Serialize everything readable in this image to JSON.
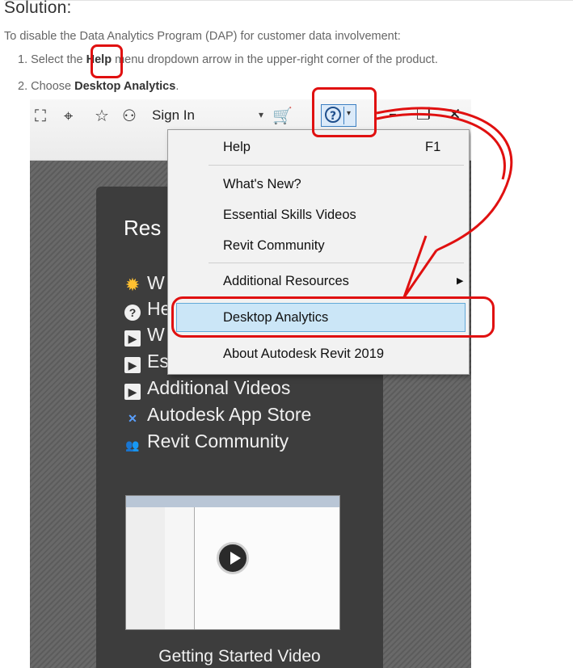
{
  "heading": "Solution:",
  "intro": "To disable the Data Analytics Program (DAP) for customer data involvement:",
  "steps": [
    {
      "num": "1.",
      "before": "Select the ",
      "bold": "Help",
      "after": " menu dropdown arrow in the upper-right corner of the product."
    },
    {
      "num": "2.",
      "before": "Choose ",
      "bold": "Desktop Analytics",
      "after": "."
    }
  ],
  "ribbon": {
    "icons": [
      "binoculars-icon",
      "satellite-icon",
      "star-icon",
      "user-icon"
    ],
    "sign_in": "Sign In",
    "dropdown_arrow": "▾",
    "cart_icon": "🛒",
    "help_glyph": "?",
    "help_dropdown": "▾",
    "minimize": "–",
    "restore": "❐",
    "close": "✕"
  },
  "menu": {
    "items": [
      {
        "label": "Help",
        "shortcut": "F1"
      },
      {
        "label": "What's New?"
      },
      {
        "label": "Essential Skills Videos"
      },
      {
        "label": "Revit Community"
      },
      {
        "label": "Additional Resources",
        "submenu": "▶"
      },
      {
        "label": "Desktop Analytics",
        "highlighted": true
      },
      {
        "label": "About Autodesk Revit 2019"
      }
    ]
  },
  "resources": {
    "title": "Res",
    "items": [
      {
        "label": "W",
        "icon": "sun-icon"
      },
      {
        "label": "He",
        "icon": "help-circle-icon"
      },
      {
        "label": "W",
        "icon": "play-icon"
      },
      {
        "label": "Es",
        "icon": "play-icon"
      },
      {
        "label": "Additional Videos",
        "icon": "play-icon"
      },
      {
        "label": "Autodesk App Store",
        "icon": "autodesk-x-icon"
      },
      {
        "label": "Revit Community",
        "icon": "people-icon"
      }
    ],
    "video_caption": "Getting Started Video"
  },
  "colors": {
    "annotation_red": "#e01010",
    "highlight": "#cbe6f7",
    "panel": "#3d3d3d"
  }
}
